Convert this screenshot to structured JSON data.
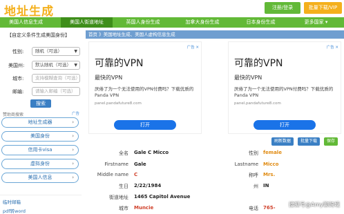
{
  "header": {
    "logo": "地址生成",
    "login_register": "注册/登录",
    "bulk_download": "批量下载/VIP",
    "colors": {
      "logo": "#f4b01c",
      "nav": "#62b937",
      "accent_blue": "#3a7fc4"
    }
  },
  "nav": {
    "items": [
      {
        "label": "美国人信息生成"
      },
      {
        "label": "美国人街道地址"
      },
      {
        "label": "英国人身份生成"
      },
      {
        "label": "加拿大身份生成"
      },
      {
        "label": "日本身份生成"
      },
      {
        "label": "更多国家 ▾"
      }
    ]
  },
  "sidebar": {
    "title": "【自定义条件生成美国身份】",
    "fields": [
      {
        "label": "性别:",
        "value": "随机（可选）"
      },
      {
        "label": "美国州:",
        "value": "默认随机（可选）"
      },
      {
        "label": "城市:",
        "placeholder": "支持模糊查询（可选）"
      },
      {
        "label": "邮编:",
        "placeholder": "请输入邮编（可选）"
      }
    ],
    "search_button": "搜索",
    "recommend_label": "赞助商搜索",
    "ad_mark": "广告",
    "pills": [
      {
        "label": "地址生成器"
      },
      {
        "label": "美国身份"
      },
      {
        "label": "信用卡visa"
      },
      {
        "label": "虚拟身份"
      },
      {
        "label": "美国人信息"
      }
    ],
    "bottom_links": [
      "临时邮箱",
      "pdf转word"
    ]
  },
  "main": {
    "breadcrumb": "首页 》美国地址生成、美国人虚构信息生成",
    "ads": [
      {
        "title": "可靠的VPN",
        "subtitle": "最快的VPN",
        "text": "厌倦了为一个无法使用的VPN付费吗？下载优质的Panda VPN",
        "domain": "panel.pandafuture8.com",
        "button": "打开",
        "mark": "广告 ✕"
      },
      {
        "title": "可靠的VPN",
        "subtitle": "最快的VPN",
        "text": "厌倦了为一个无法使用的VPN付费吗？下载优质的Panda VPN",
        "domain": "panel.pandafuture8.com",
        "button": "打开",
        "mark": "广告 ✕"
      }
    ],
    "actions": [
      "刷新数据",
      "批量下载",
      "保存"
    ],
    "details_left": [
      {
        "label": "全名",
        "value": "Gale C Micco",
        "color": "normal"
      },
      {
        "label": "Firstname",
        "value": "Gale",
        "color": "normal"
      },
      {
        "label": "Middle name",
        "value": "C",
        "color": "red"
      },
      {
        "label": "生日",
        "value": "2/22/1984",
        "color": "normal"
      },
      {
        "label": "街道地址",
        "value": "1465 Capitol Avenue",
        "color": "normal"
      },
      {
        "label": "城市",
        "value": "Muncie",
        "color": "red"
      }
    ],
    "details_right": [
      {
        "label": "性别",
        "value": "female",
        "color": "orange"
      },
      {
        "label": "Lastname",
        "value": "Micco",
        "color": "orange"
      },
      {
        "label": "称呼",
        "value": "Mrs.",
        "color": "orange"
      },
      {
        "label": "州",
        "value": "IN",
        "color": "normal"
      },
      {
        "label": "",
        "value": "",
        "color": "normal"
      },
      {
        "label": "电话",
        "value": "765-",
        "color": "red"
      }
    ],
    "watermark": "搜狐号@Amy聊跨境"
  }
}
